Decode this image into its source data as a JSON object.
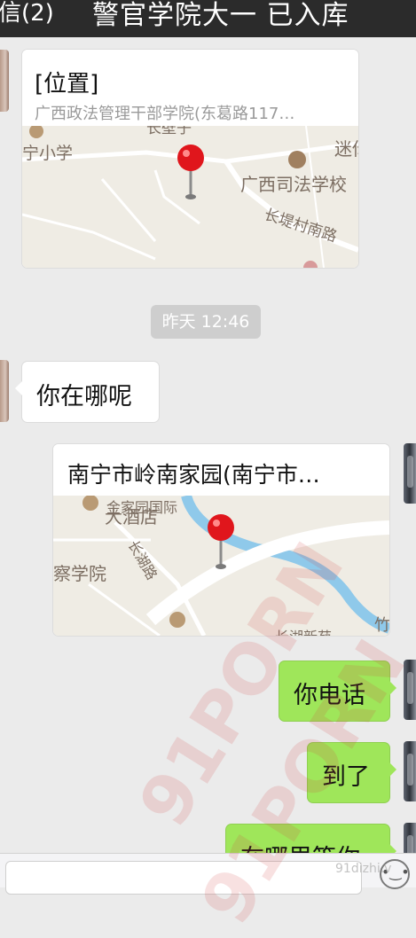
{
  "header": {
    "back_label": "信(2)",
    "title": "警官学院大一 已入库"
  },
  "messages": {
    "location1": {
      "title": "[位置]",
      "address": "广西政法管理干部学院(东葛路117…",
      "map_labels": {
        "school_primary": "宁小学",
        "justice_school": "广西司法学校",
        "road_changdi": "长堤村南路",
        "top_partial": "长壁子",
        "right_partial": "迷你"
      }
    },
    "timestamp": "昨天 12:46",
    "incoming_text": "你在哪呢",
    "location2": {
      "title": "南宁市岭南家园(南宁市…",
      "map_labels": {
        "hotel": "大酒店",
        "hotel_partial": "金家园国际",
        "police_school": "察学院",
        "road_changhu": "长湖路",
        "bottom_partial": "长湖新苑",
        "right_partial": "竹"
      }
    },
    "outgoing_1": "你电话",
    "outgoing_2": "到了",
    "outgoing_3_partial": "在哪里等你"
  },
  "watermark": {
    "text": "91PORN",
    "small": "91dizhi.v"
  },
  "icons": {
    "emoji": "emoji-icon",
    "pin": "map-pin-icon"
  },
  "colors": {
    "topbar": "#2b2b2b",
    "chat_bg": "#ebebeb",
    "outgoing_bubble": "#9fe65a",
    "pin": "#e0161c"
  }
}
